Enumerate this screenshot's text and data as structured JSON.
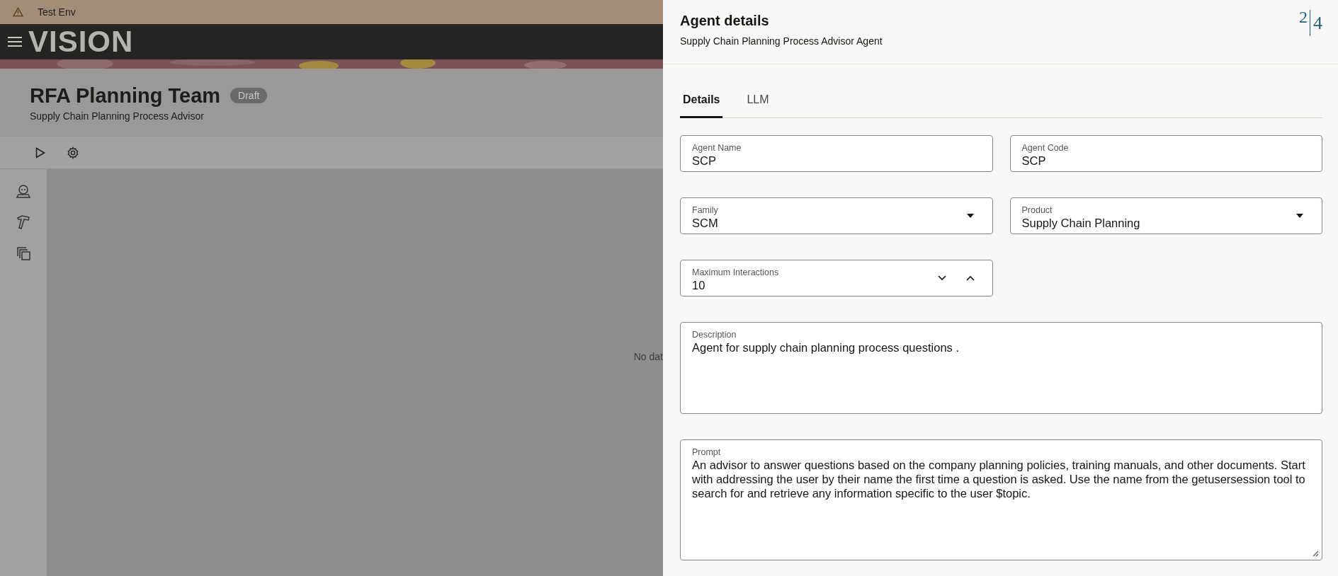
{
  "environment_banner": {
    "label": "Test Env"
  },
  "app_bar": {
    "logo": "VISION"
  },
  "page_header": {
    "title": "RFA Planning Team",
    "status": "Draft",
    "subtitle": "Supply Chain Planning Process Advisor"
  },
  "content": {
    "empty_message": "No dat"
  },
  "drawer": {
    "title": "Agent details",
    "subtitle": "Supply Chain Planning Process Advisor Agent",
    "logo": [
      "2",
      "4"
    ],
    "tabs": [
      {
        "label": "Details",
        "selected": true
      },
      {
        "label": "LLM",
        "selected": false
      }
    ],
    "fields": [
      {
        "kind": "text",
        "label": "Agent Name",
        "value": "SCP"
      },
      {
        "kind": "text",
        "label": "Agent Code",
        "value": "SCP"
      },
      {
        "kind": "select",
        "label": "Family",
        "value": "SCM"
      },
      {
        "kind": "select",
        "label": "Product",
        "value": "Supply Chain Planning"
      },
      {
        "kind": "number",
        "label": "Maximum Interactions",
        "value": "10"
      },
      {
        "kind": "textarea",
        "label": "Description",
        "value": "Agent for supply chain planning process questions ."
      },
      {
        "kind": "textarea",
        "label": "Prompt",
        "value": "An advisor to answer questions based on the company planning policies, training manuals, and other documents. Start with addressing the user by their name the first time a question is asked. Use the name from the getusersession tool to search for and retrieve any information specific to the user $topic."
      }
    ]
  }
}
